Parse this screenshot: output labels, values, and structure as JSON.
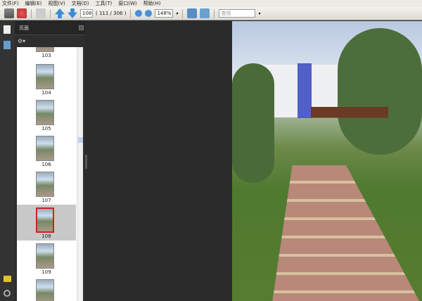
{
  "menu": [
    "文件(F)",
    "编辑(E)",
    "视图(V)",
    "文档(D)",
    "工具(T)",
    "窗口(W)",
    "帮助(H)"
  ],
  "toolbar": {
    "page_input": "108",
    "page_count": "( 111 / 306 )",
    "zoom": "148%",
    "search_placeholder": "查找"
  },
  "panel": {
    "title": "页面"
  },
  "thumbnails": [
    {
      "label": "103"
    },
    {
      "label": "104"
    },
    {
      "label": "105"
    },
    {
      "label": "106"
    },
    {
      "label": "107"
    },
    {
      "label": "108",
      "selected": true
    },
    {
      "label": "109"
    }
  ],
  "colors": {
    "selected_border": "#cc2222",
    "panel_bg": "#2e2e2e"
  }
}
